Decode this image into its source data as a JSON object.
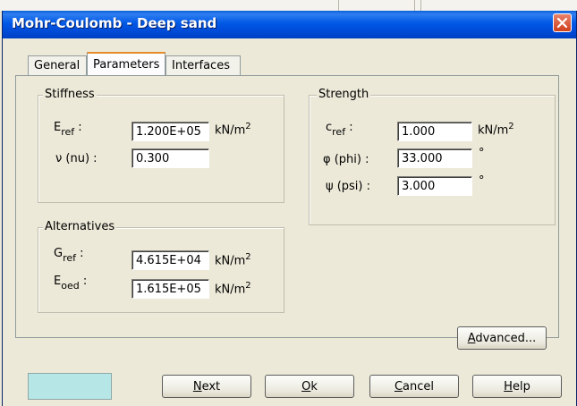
{
  "window": {
    "title": "Mohr-Coulomb - Deep sand",
    "close_glyph": "✕"
  },
  "tabs": [
    {
      "label": "General",
      "active": false
    },
    {
      "label": "Parameters",
      "active": true
    },
    {
      "label": "Interfaces",
      "active": false
    }
  ],
  "stiffness": {
    "legend": "Stiffness",
    "e_ref": {
      "symbol": "E",
      "subscript": "ref",
      "colon": ":",
      "value": "1.200E+05",
      "unit": "kN/m",
      "unit_exp": "2"
    },
    "nu": {
      "label": "ν (nu) :",
      "value": "0.300"
    }
  },
  "strength": {
    "legend": "Strength",
    "c_ref": {
      "symbol": "c",
      "subscript": "ref",
      "colon": ":",
      "value": "1.000",
      "unit": "kN/m",
      "unit_exp": "2"
    },
    "phi": {
      "label": "φ (phi) :",
      "value": "33.000",
      "unit": "°"
    },
    "psi": {
      "label": "ψ (psi) :",
      "value": "3.000",
      "unit": "°"
    }
  },
  "alternatives": {
    "legend": "Alternatives",
    "g_ref": {
      "symbol": "G",
      "subscript": "ref",
      "colon": ":",
      "value": "4.615E+04",
      "unit": "kN/m",
      "unit_exp": "2"
    },
    "e_oed": {
      "symbol": "E",
      "subscript": "oed",
      "colon": ":",
      "value": "1.615E+05",
      "unit": "kN/m",
      "unit_exp": "2"
    }
  },
  "buttons": {
    "advanced": {
      "label": "Advanced...",
      "accel": "A",
      "rest": "dvanced..."
    },
    "next": {
      "label": "Next",
      "accel": "N",
      "rest": "ext"
    },
    "ok": {
      "label": "Ok",
      "accel": "O",
      "rest": "k"
    },
    "cancel": {
      "label": "Cancel",
      "accel": "C",
      "rest": "ancel"
    },
    "help": {
      "label": "Help",
      "accel": "H",
      "rest": "elp"
    }
  },
  "colors": {
    "titlebar": "#0058e6",
    "swatch": "#b6e6e6",
    "close": "#d0401d"
  }
}
